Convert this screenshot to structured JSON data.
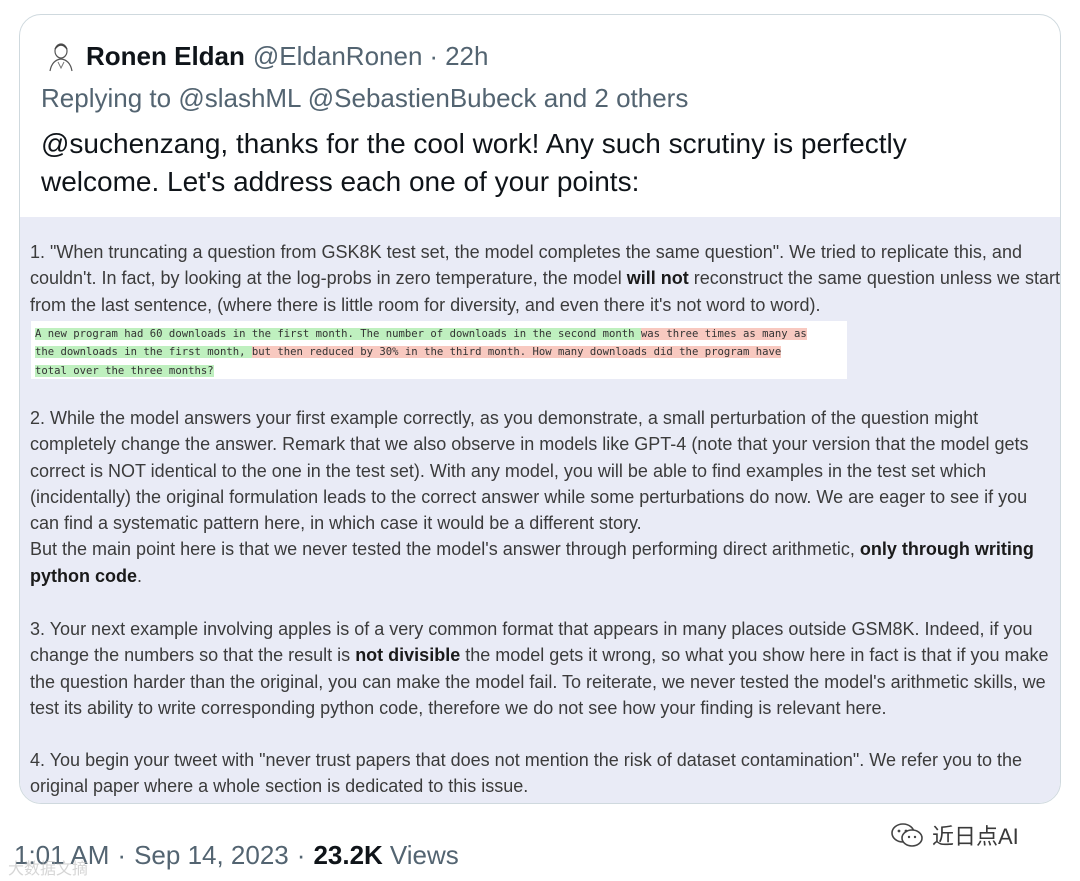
{
  "tweet": {
    "author_name": "Ronen Eldan",
    "author_handle": "@EldanRonen",
    "separator": "·",
    "time_ago": "22h",
    "replying_prefix": "Replying to",
    "reply_mentions": "@slashML @SebastienBubeck",
    "reply_suffix": "and 2 others",
    "text": "@suchenzang, thanks for the cool work! Any such scrutiny is perfectly welcome. Let's address each one of your points:",
    "footer": {
      "time": "1:01 AM",
      "separator": "·",
      "date": "Sep 14, 2023",
      "views_count": "23.2K",
      "views_label": "Views"
    }
  },
  "image": {
    "p1_a": "1. \"When truncating a question from GSK8K test set, the model completes the same question\". We tried to replicate this, and couldn't. In fact, by looking at the log-probs in zero temperature, the model ",
    "p1_bold": "will not",
    "p1_b": " reconstruct the same question unless we start from the last sentence, (where there is little room for diversity, and even there it's not word to word).",
    "snippet": {
      "l1_a": "A new program had 60 downloads in the first month. The number of downloads in the second month ",
      "l1_b": "was three times as many as",
      "l2_a": "the downloads in the first month, ",
      "l2_b": "but then reduced by 30% in the third month. How many downloads did the program have",
      "l3_a": "total over the three months?"
    },
    "p2_a": "2. While the model answers your first example correctly, as you demonstrate, a small perturbation of the question might completely change the answer. Remark that we also observe in models like GPT-4 (note that your version that the model gets correct is NOT identical to the one in the test set). With any model, you will be able to find examples in the test set which (incidentally) the original formulation leads to the correct answer while some perturbations do now. We are eager to see if you can find a systematic pattern here, in which case it would be a different story.",
    "p2_b": "But the main point here is that we never tested the model's answer through performing direct arithmetic, ",
    "p2_bold": "only through writing python code",
    "p2_c": ".",
    "p3_a": "3. Your next example involving apples is of a very common format that appears in many places outside GSM8K. Indeed, if you change the numbers so that the result is ",
    "p3_bold": "not divisible",
    "p3_b": " the model gets it wrong, so what you show here in fact is that if you make the question harder than the original, you can make the model fail. To reiterate, we never tested the model's arithmetic skills, we test its ability to write corresponding python code, therefore we do not see how your finding is relevant here.",
    "p4": "4. You begin your tweet with \"never trust papers that does not mention the risk of dataset contamination\". We refer you to the original paper where a whole section is dedicated to this issue."
  },
  "watermark": {
    "right_text": "近日点AI",
    "left_text": "大数据文摘"
  },
  "colors": {
    "text_primary": "#0f1419",
    "text_secondary": "#536471",
    "image_bg": "#e9ebf6",
    "highlight_green": "#bff0bf",
    "highlight_red": "#f8c9c0"
  },
  "icons": {
    "avatar": "avatar-sketch",
    "watermark": "wechat-icon"
  }
}
